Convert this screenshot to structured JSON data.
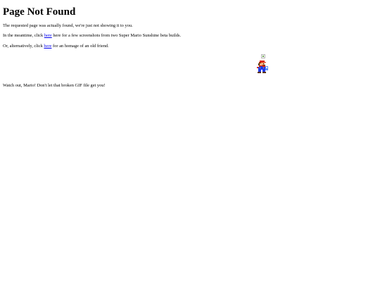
{
  "page": {
    "title": "Page Not Found",
    "line1": "The requested page was actually found, we're just not showing it to you.",
    "line2": {
      "before": "In the meantime, click ",
      "link": "here",
      "after": " here for a few screenshots from two Super Mario Sunshine beta builds."
    },
    "line3": {
      "before": "Or, alternatively, click ",
      "link": "here",
      "after": " for an homage of an old friend."
    },
    "caption": "Watch out, Mario! Don't let that broken GIF file get you!"
  },
  "icons": {
    "broken_image": "broken-image-icon",
    "mario_sprite": "mario-sprite"
  },
  "colors": {
    "link": "#0000ee",
    "text": "#000000",
    "background": "#ffffff"
  }
}
